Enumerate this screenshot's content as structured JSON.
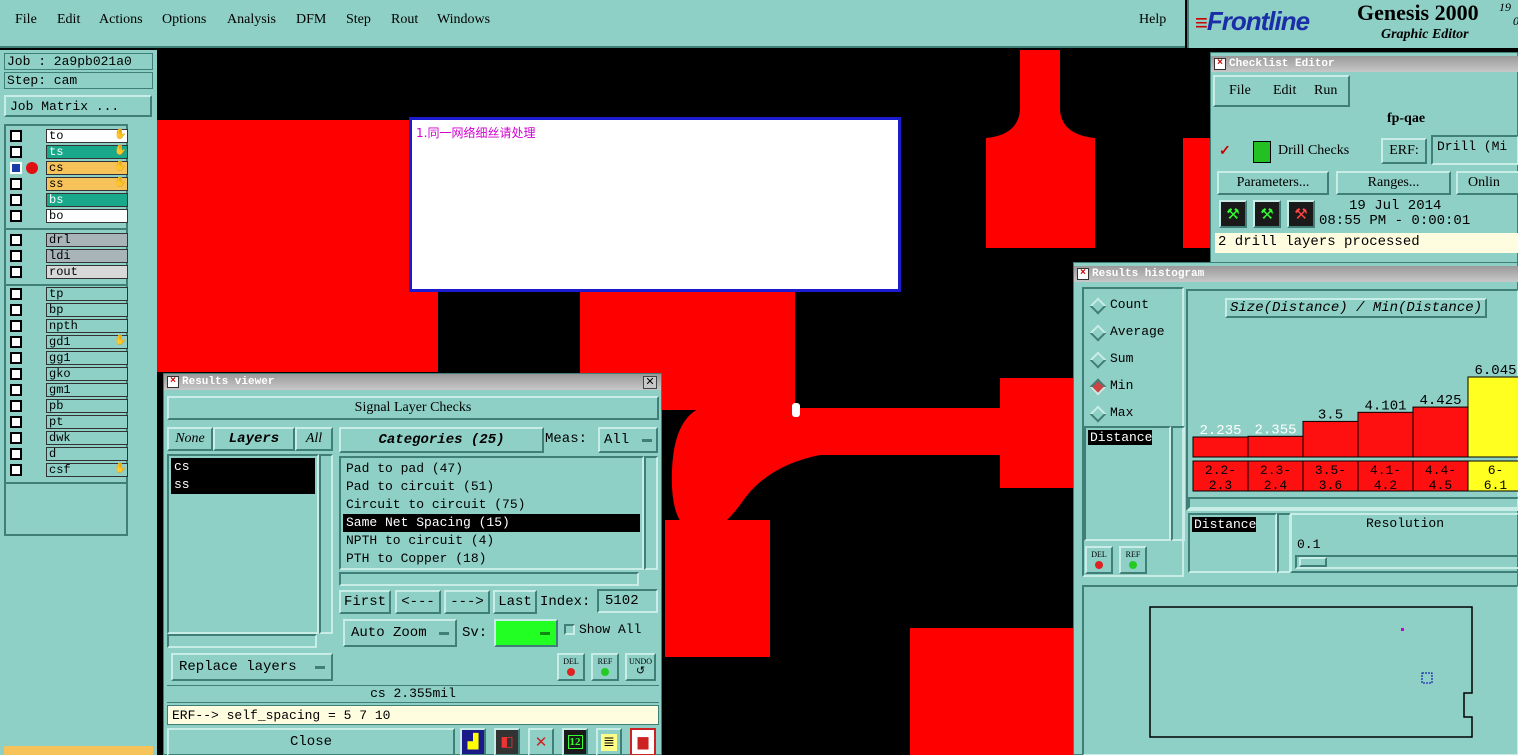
{
  "menubar": {
    "items": [
      "File",
      "Edit",
      "Actions",
      "Options",
      "Analysis",
      "DFM",
      "Step",
      "Rout",
      "Windows"
    ],
    "help": "Help"
  },
  "brand": {
    "logo": "Frontline",
    "product": "Genesis 2000",
    "version_top": "19",
    "version_bottom": "0",
    "subtitle": "Graphic Editor"
  },
  "job": {
    "job_label": "Job : 2a9pb021a0",
    "step_label": "Step: cam",
    "matrix_button": "Job Matrix ..."
  },
  "layers": {
    "group1": [
      "to",
      "ts",
      "cs",
      "ss",
      "bs",
      "bo"
    ],
    "group2": [
      "drl",
      "ldi",
      "rout"
    ],
    "group3": [
      "tp",
      "bp",
      "npth",
      "gd1",
      "gg1",
      "gko",
      "gm1",
      "pb",
      "pt",
      "dwk",
      "d",
      "csf"
    ],
    "active": "cs"
  },
  "note": {
    "text": "1.同一网络细丝请处理"
  },
  "results_viewer": {
    "title": "Results viewer",
    "header": "Signal Layer Checks",
    "none_btn": "None",
    "layers_btn": "Layers",
    "all_btn": "All",
    "layer_list": [
      "cs",
      "ss"
    ],
    "categories_label": "Categories (25)",
    "meas_label": "Meas:",
    "meas_value": "All",
    "categories": [
      "Pad to pad (47)",
      "Pad to circuit (51)",
      "Circuit to circuit (75)",
      "Same Net Spacing (15)",
      "NPTH to circuit (4)",
      "PTH to Copper (18)"
    ],
    "selected_category": "Same Net Spacing (15)",
    "nav": {
      "first": "First",
      "prev": "<---",
      "next": "--->",
      "last": "Last",
      "index_label": "Index:",
      "index_value": "5102"
    },
    "auto_zoom": "Auto Zoom",
    "sv_label": "Sv:",
    "show_all": "Show All",
    "replace_layers": "Replace layers",
    "tool_labels": {
      "del": "DEL",
      "ref": "REF",
      "undo": "UNDO"
    },
    "status": "cs 2.355mil",
    "erf": "ERF--> self_spacing = 5 7 10",
    "close": "Close"
  },
  "checklist": {
    "title": "Checklist Editor",
    "menu": [
      "File",
      "Edit",
      "Run"
    ],
    "name": "fp-qae",
    "check_name": "Drill Checks",
    "erf_label": "ERF:",
    "erf_value": "Drill (Mi",
    "parameters_btn": "Parameters...",
    "ranges_btn": "Ranges...",
    "online_btn": "Onlin",
    "date": "19 Jul 2014",
    "time": "08:55 PM - 0:00:01",
    "status": "2 drill layers processed"
  },
  "histogram": {
    "title": "Results histogram",
    "modes": [
      "Count",
      "Average",
      "Sum",
      "Min",
      "Max"
    ],
    "selected_mode": "Min",
    "chart_title": "Size(Distance) / Min(Distance)",
    "field_list": [
      "Distance"
    ],
    "sort_label": "Distance",
    "resolution_label": "Resolution",
    "resolution_value": "0.1",
    "tool_labels": {
      "del": "DEL",
      "ref": "REF"
    },
    "colors": {
      "bar": "#ff1010",
      "highlight": "#ffff20"
    }
  },
  "chart_data": {
    "type": "bar",
    "title": "Size(Distance) / Min(Distance)",
    "categories": [
      "2.2-2.3",
      "2.3-2.4",
      "3.5-3.6",
      "4.1-4.2",
      "4.4-4.5",
      "6-6.1"
    ],
    "category_labels": [
      [
        "2.2-",
        "2.3"
      ],
      [
        "2.3-",
        "2.4"
      ],
      [
        "3.5-",
        "3.6"
      ],
      [
        "4.1-",
        "4.2"
      ],
      [
        "4.4-",
        "4.5"
      ],
      [
        "6-",
        "6.1"
      ]
    ],
    "values": [
      2.235,
      2.355,
      3.5,
      4.101,
      4.425,
      6.045
    ],
    "value_labels": [
      "2.235",
      "2.355",
      "3.5",
      "4.101",
      "4.425",
      "6.045"
    ],
    "highlight_index": 5,
    "grid": false,
    "legend": "none"
  }
}
